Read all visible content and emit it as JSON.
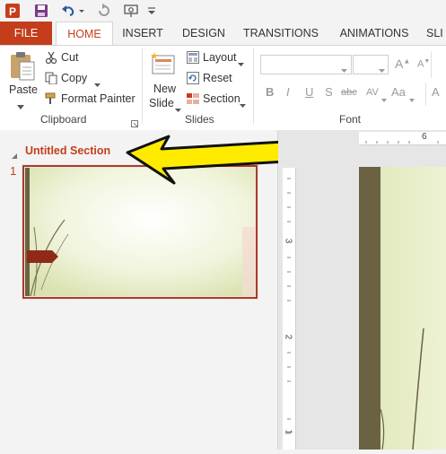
{
  "qat": {
    "icons": [
      "powerpoint-logo-icon",
      "save-icon",
      "undo-icon",
      "undo-dropdown-icon",
      "redo-icon",
      "start-from-beginning-icon",
      "customize-dropdown-icon"
    ]
  },
  "tabs": [
    "FILE",
    "HOME",
    "INSERT",
    "DESIGN",
    "TRANSITIONS",
    "ANIMATIONS",
    "SLI"
  ],
  "clipboard": {
    "paste": "Paste",
    "cut": "Cut",
    "copy": "Copy",
    "format_painter": "Format Painter",
    "label": "Clipboard"
  },
  "slides": {
    "new_slide_line1": "New",
    "new_slide_line2": "Slide",
    "layout": "Layout",
    "reset": "Reset",
    "section": "Section",
    "label": "Slides"
  },
  "font": {
    "label": "Font",
    "buttons": [
      "B",
      "I",
      "U",
      "S",
      "abc",
      "AV",
      "Aa",
      "A"
    ]
  },
  "pane": {
    "section_title": "Untitled Section",
    "slide_number": "1"
  },
  "ruler": {
    "h_tick": "6",
    "v_ticks": [
      "3",
      "2",
      "1"
    ]
  },
  "colors": {
    "accent": "#c43e1c",
    "arrow": "#ffeb00",
    "slide_border": "#a0402a"
  }
}
